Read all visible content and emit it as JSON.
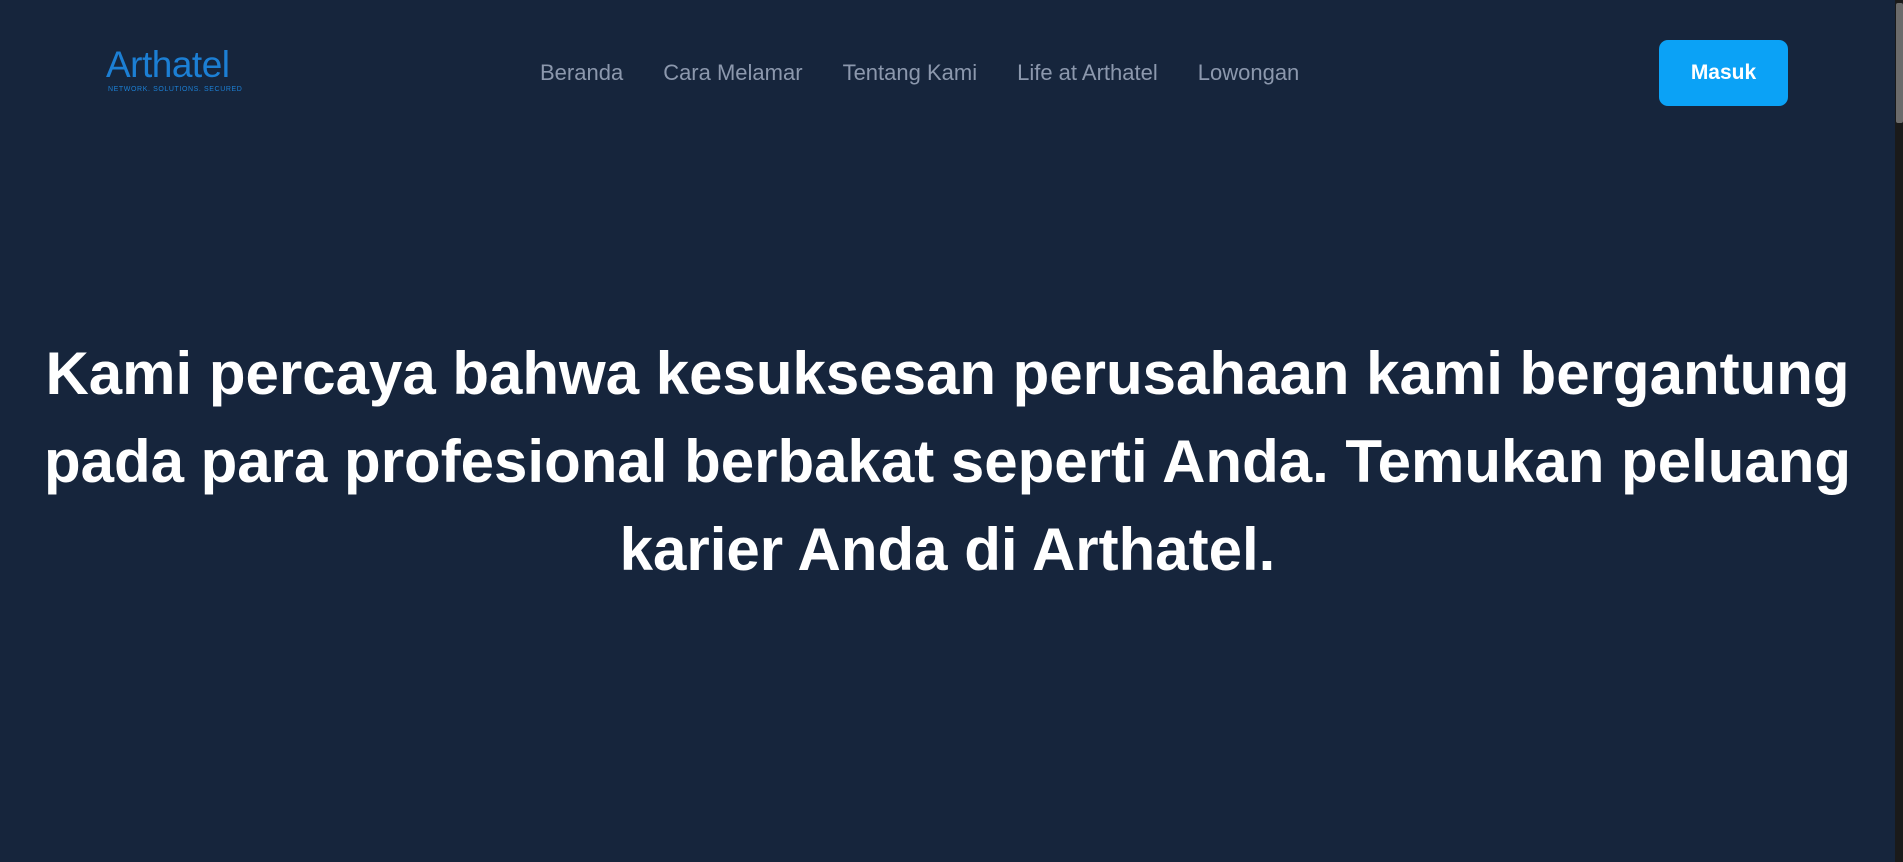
{
  "header": {
    "logo": {
      "wordmark": "Arthatel",
      "tagline": "NETWORK. SOLUTIONS. SECURED"
    },
    "nav": [
      {
        "label": "Beranda"
      },
      {
        "label": "Cara Melamar"
      },
      {
        "label": "Tentang Kami"
      },
      {
        "label": "Life at Arthatel"
      },
      {
        "label": "Lowongan"
      }
    ],
    "login_label": "Masuk"
  },
  "hero": {
    "title": "Kami percaya bahwa kesuksesan perusahaan kami bergantung pada para profesional berbakat seperti Anda. Temukan peluang karier Anda di Arthatel."
  },
  "colors": {
    "background": "#16253c",
    "brand": "#1c7fd4",
    "accent": "#0ba2f6",
    "nav_text": "#8c98ad"
  }
}
